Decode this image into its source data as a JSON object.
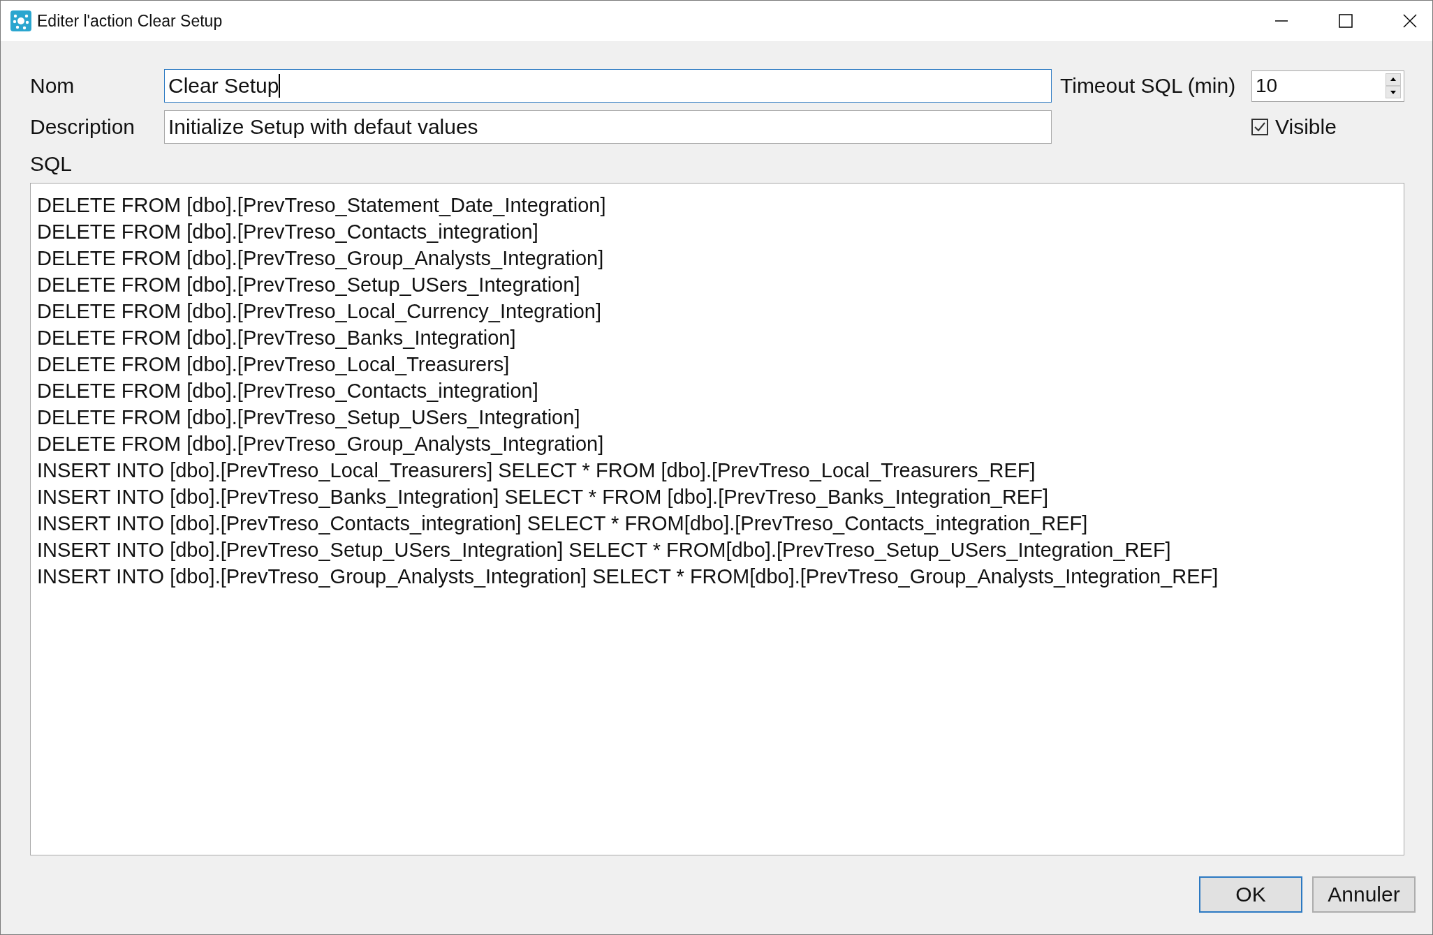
{
  "window": {
    "title": "Editer l'action Clear Setup"
  },
  "form": {
    "name_label": "Nom",
    "name_value": "Clear Setup",
    "name_focused": true,
    "description_label": "Description",
    "description_value": "Initialize Setup with defaut values",
    "timeout_label": "Timeout SQL (min)",
    "timeout_value": "10",
    "visible_label": "Visible",
    "visible_checked": true,
    "sql_label": "SQL"
  },
  "sql": [
    "DELETE FROM [dbo].[PrevTreso_Statement_Date_Integration]",
    "DELETE FROM [dbo].[PrevTreso_Contacts_integration]",
    "DELETE FROM [dbo].[PrevTreso_Group_Analysts_Integration]",
    "DELETE FROM [dbo].[PrevTreso_Setup_USers_Integration]",
    "DELETE FROM [dbo].[PrevTreso_Local_Currency_Integration]",
    "DELETE FROM [dbo].[PrevTreso_Banks_Integration]",
    "DELETE FROM [dbo].[PrevTreso_Local_Treasurers]",
    "DELETE FROM [dbo].[PrevTreso_Contacts_integration]",
    "DELETE FROM [dbo].[PrevTreso_Setup_USers_Integration]",
    "DELETE FROM [dbo].[PrevTreso_Group_Analysts_Integration]",
    "INSERT INTO [dbo].[PrevTreso_Local_Treasurers] SELECT * FROM [dbo].[PrevTreso_Local_Treasurers_REF]",
    "INSERT INTO [dbo].[PrevTreso_Banks_Integration] SELECT * FROM [dbo].[PrevTreso_Banks_Integration_REF]",
    "INSERT INTO [dbo].[PrevTreso_Contacts_integration] SELECT * FROM[dbo].[PrevTreso_Contacts_integration_REF]",
    "INSERT INTO [dbo].[PrevTreso_Setup_USers_Integration] SELECT * FROM[dbo].[PrevTreso_Setup_USers_Integration_REF]",
    "INSERT INTO [dbo].[PrevTreso_Group_Analysts_Integration] SELECT * FROM[dbo].[PrevTreso_Group_Analysts_Integration_REF]"
  ],
  "buttons": [
    {
      "label": "OK",
      "default": true
    },
    {
      "label": "Annuler",
      "default": false
    }
  ]
}
